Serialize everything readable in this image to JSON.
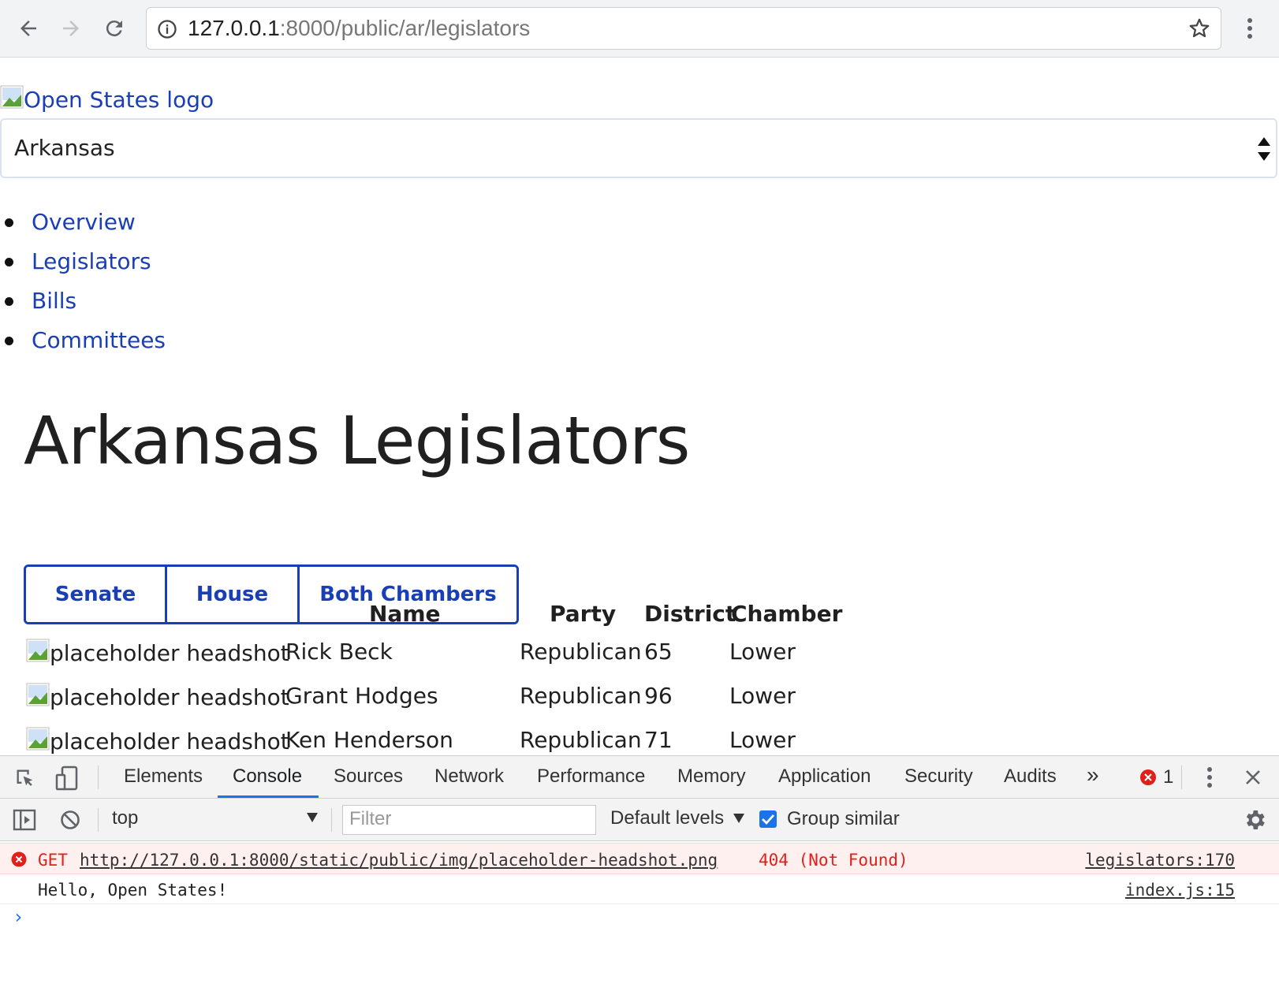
{
  "browser": {
    "url_host": "127.0.0.1",
    "url_rest": ":8000/public/ar/legislators"
  },
  "page": {
    "logo_alt": "Open States logo",
    "state_select": {
      "value": "Arkansas"
    },
    "nav": [
      "Overview",
      "Legislators",
      "Bills",
      "Committees"
    ],
    "title": "Arkansas Legislators",
    "chamber_buttons": [
      "Senate",
      "House",
      "Both Chambers"
    ],
    "table": {
      "headers": [
        "Name",
        "Party",
        "District",
        "Chamber"
      ],
      "image_alt": "placeholder headshot",
      "rows": [
        {
          "name": "Rick Beck",
          "party": "Republican",
          "district": "65",
          "chamber": "Lower"
        },
        {
          "name": "Grant Hodges",
          "party": "Republican",
          "district": "96",
          "chamber": "Lower"
        },
        {
          "name": "Ken Henderson",
          "party": "Republican",
          "district": "71",
          "chamber": "Lower"
        }
      ]
    },
    "link_color": "#1a3fb5"
  },
  "devtools": {
    "tabs": [
      "Elements",
      "Console",
      "Sources",
      "Network",
      "Performance",
      "Memory",
      "Application",
      "Security",
      "Audits"
    ],
    "active_tab": "Console",
    "more_tabs": "»",
    "error_count": "1",
    "context": "top",
    "filter_placeholder": "Filter",
    "levels": "Default levels",
    "group_similar": "Group similar",
    "messages": [
      {
        "type": "error",
        "method": "GET",
        "url": "http://127.0.0.1:8000/static/public/img/placeholder-headshot.png",
        "status": "404 (Not Found)",
        "source": "legislators:170"
      },
      {
        "type": "log",
        "text": "Hello, Open States!",
        "source": "index.js:15"
      }
    ],
    "prompt": "›"
  }
}
